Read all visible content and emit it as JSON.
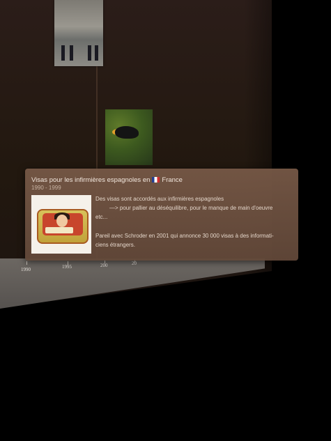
{
  "background_text": {
    "line_a": "",
    "line_b": "",
    "left_note": "",
    "arrow_line": "",
    "section_title": "",
    "section_date": ""
  },
  "popup": {
    "title": "Visas pour les infirmières espagnoles en",
    "flag_icon": "france-flag-icon",
    "country": "France",
    "dates": "1990 - 1999",
    "body_line1": "Des visas sont accordés aux infirmières espagnoles",
    "body_line2": "—> pour pallier au déséquilibre, pour le manque de main d'oeuvre",
    "body_line3": "etc...",
    "body_line4": "Pareil avec Schroder en 2001 qui annonce 30 000 visas à des informati-",
    "body_line5": "ciens étrangers."
  },
  "timeline": {
    "ticks": [
      {
        "label": "1990"
      },
      {
        "label": "1995"
      },
      {
        "label": "200"
      },
      {
        "label": "20"
      }
    ]
  }
}
